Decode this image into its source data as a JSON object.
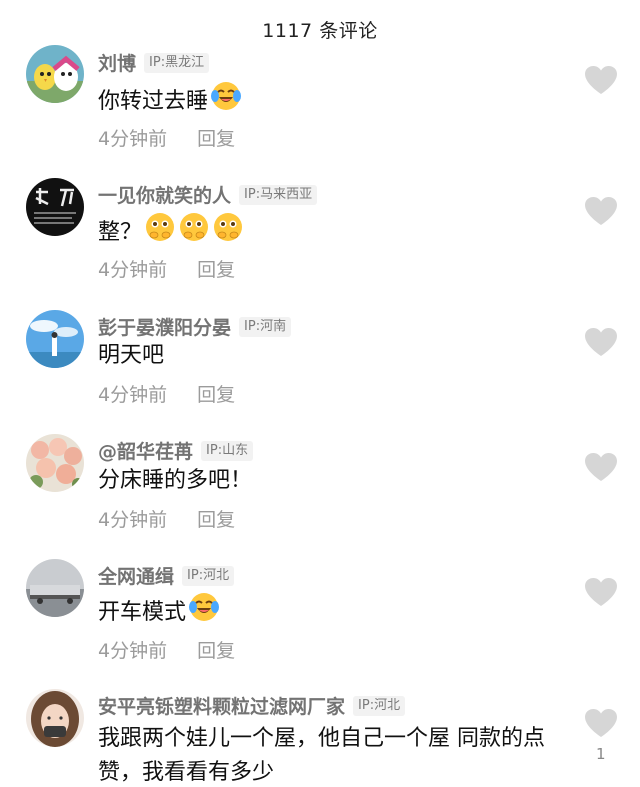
{
  "header": {
    "title": "1117 条评论"
  },
  "comments": [
    {
      "username": "刘博",
      "ip": "IP:黑龙江",
      "text": "你转过去睡",
      "emojis": [
        "laughing-crying-icon"
      ],
      "time": "4分钟前",
      "reply_label": "回复"
    },
    {
      "username": "一见你就笑的人",
      "ip": "IP:马来西亚",
      "text": "整？",
      "emojis": [
        "shy-face-icon",
        "shy-face-icon",
        "shy-face-icon"
      ],
      "time": "4分钟前",
      "reply_label": "回复"
    },
    {
      "username": "彭于晏濮阳分晏",
      "ip": "IP:河南",
      "text": "明天吧",
      "emojis": [],
      "time": "4分钟前",
      "reply_label": "回复"
    },
    {
      "username": "@韶华荏苒",
      "ip": "IP:山东",
      "text": "分床睡的多吧！",
      "emojis": [],
      "time": "4分钟前",
      "reply_label": "回复"
    },
    {
      "username": "全网通缉",
      "ip": "IP:河北",
      "text": "开车模式",
      "emojis": [
        "laughing-crying-icon"
      ],
      "time": "4分钟前",
      "reply_label": "回复"
    },
    {
      "username": "安平亮铄塑料颗粒过滤网厂家",
      "ip": "IP:河北",
      "text": "我跟两个娃儿一个屋，他自己一个屋 同款的点赞，我看看有多少",
      "emojis": [],
      "like_count": "1"
    }
  ],
  "colors": {
    "like_icon": "#d6d6d6",
    "username": "#737373",
    "meta": "#9b9b9b",
    "emoji_face": "#ffc83d"
  }
}
